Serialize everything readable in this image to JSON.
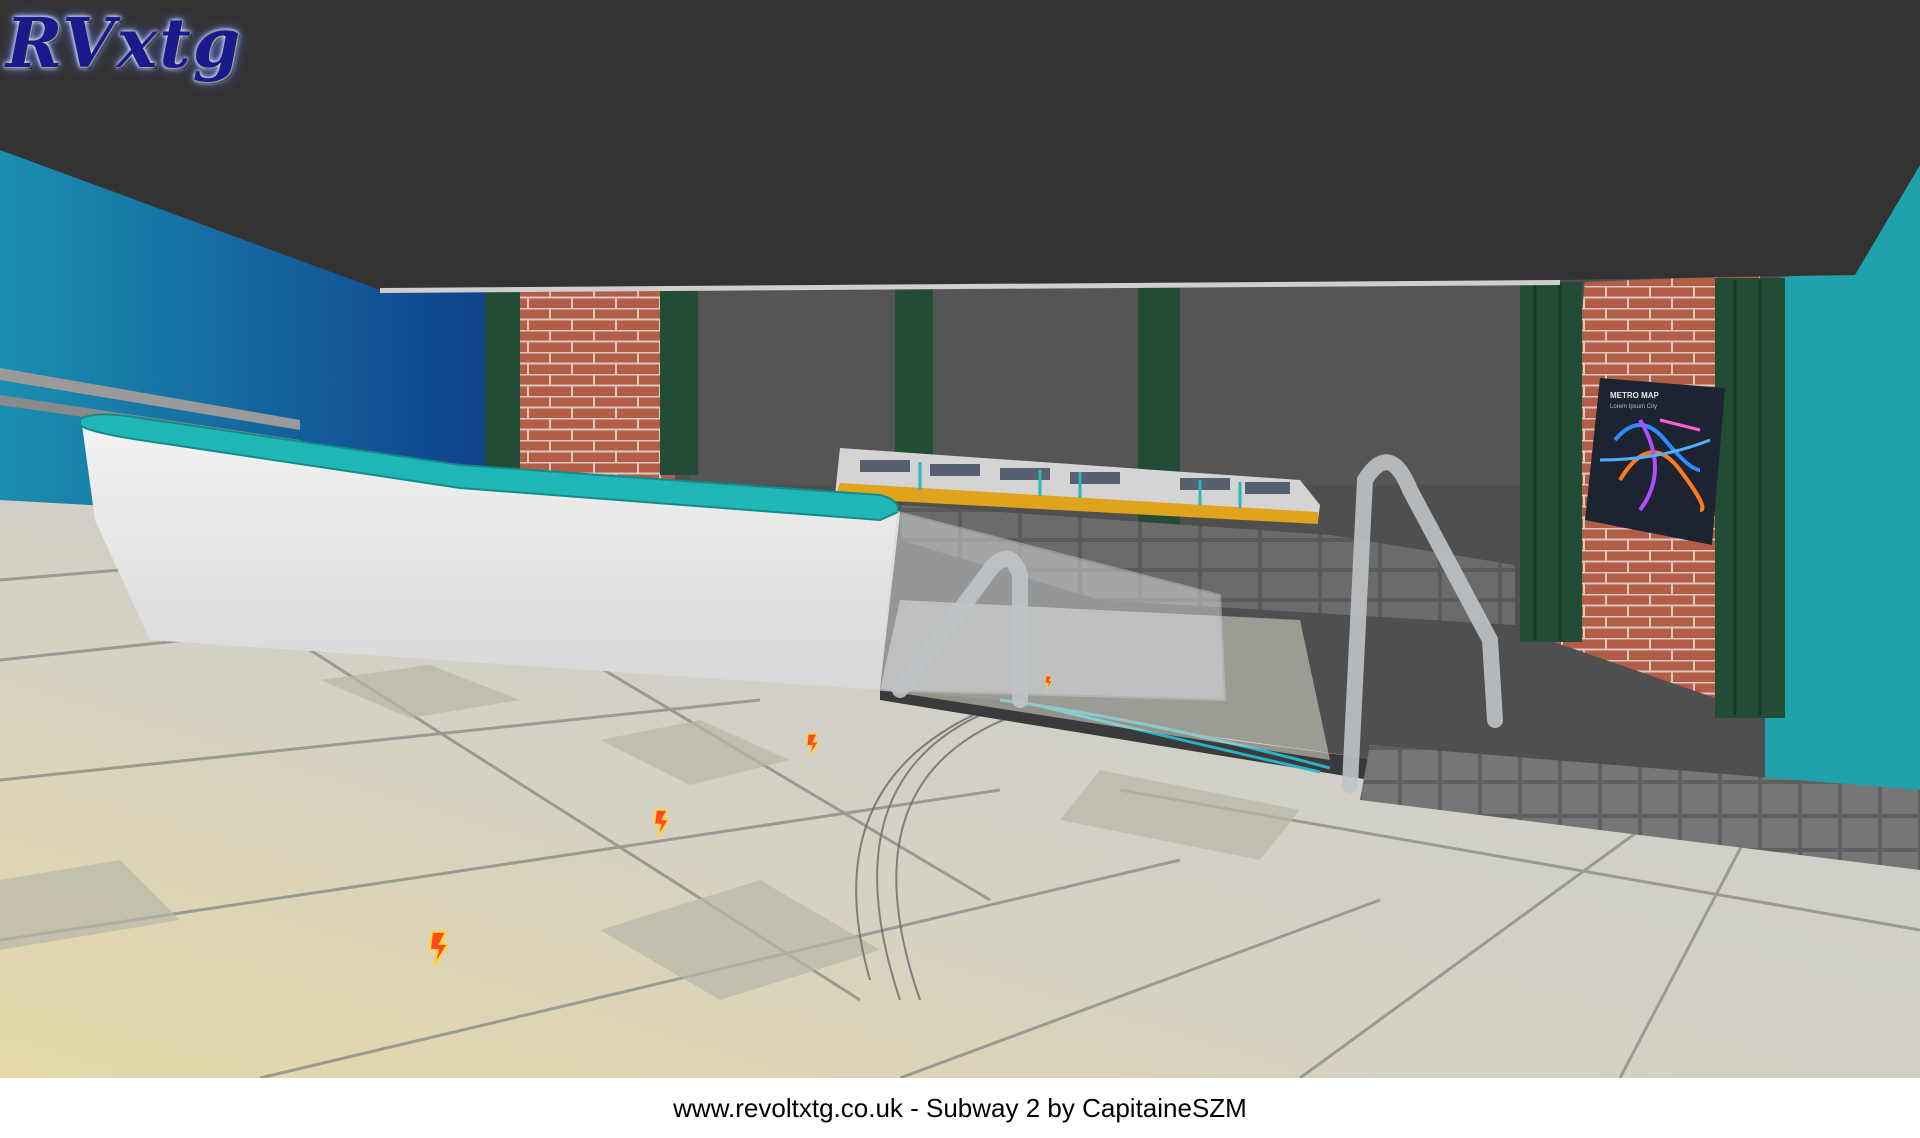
{
  "logo": {
    "text": "RVxtg"
  },
  "caption": {
    "text": "www.revoltxtg.co.uk - Subway 2 by CapitaineSZM"
  },
  "poster": {
    "title": "METRO MAP",
    "subtitle": "Lorem Ipsum City"
  },
  "colors": {
    "ceiling": "#333333",
    "back_wall": "#515151",
    "teal_wall": "#1f9aa8",
    "brick": "#b5604a",
    "pillar_green": "#1f4a35",
    "floor": "#cfcfc8",
    "railing_cap": "#1fb3b3",
    "train_body": "#d8d8d8",
    "train_stripe": "#e2a21a"
  },
  "icons": [
    "lightning-pickup-icon",
    "lightning-pickup-icon",
    "lightning-pickup-icon",
    "lightning-pickup-icon"
  ]
}
